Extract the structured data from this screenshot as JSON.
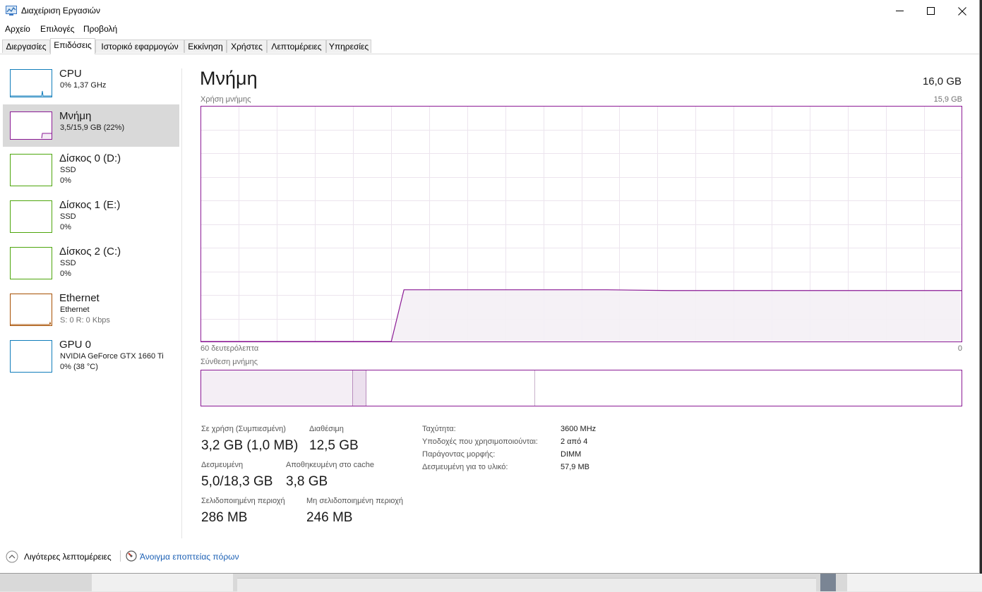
{
  "window": {
    "title": "Διαχείριση Εργασιών",
    "accent": "#8b1a95"
  },
  "menu": [
    "Αρχείο",
    "Επιλογές",
    "Προβολή"
  ],
  "tabs": [
    {
      "label": "Διεργασίες"
    },
    {
      "label": "Επιδόσεις",
      "active": true
    },
    {
      "label": "Ιστορικό εφαρμογών"
    },
    {
      "label": "Εκκίνηση"
    },
    {
      "label": "Χρήστες"
    },
    {
      "label": "Λεπτομέρειες"
    },
    {
      "label": "Υπηρεσίες"
    }
  ],
  "sidebar": {
    "items": [
      {
        "title": "CPU",
        "line1": "0% 1,37 GHz",
        "color": "#117dbb",
        "icon": "cpu-graph"
      },
      {
        "title": "Μνήμη",
        "line1": "3,5/15,9 GB (22%)",
        "color": "#8b1a95",
        "icon": "memory-graph",
        "selected": true
      },
      {
        "title": "Δίσκος 0 (D:)",
        "line1": "SSD",
        "line2": "0%",
        "color": "#4da60c",
        "icon": "disk-graph"
      },
      {
        "title": "Δίσκος 1 (E:)",
        "line1": "SSD",
        "line2": "0%",
        "color": "#4da60c",
        "icon": "disk-graph"
      },
      {
        "title": "Δίσκος 2 (C:)",
        "line1": "SSD",
        "line2": "0%",
        "color": "#4da60c",
        "icon": "disk-graph"
      },
      {
        "title": "Ethernet",
        "line1": "Ethernet",
        "line2": "S: 0 R: 0 Kbps",
        "color": "#a74f01",
        "icon": "network-graph"
      },
      {
        "title": "GPU 0",
        "line1": "NVIDIA GeForce GTX 1660 Ti",
        "line2": "0% (38 °C)",
        "color": "#117dbb",
        "icon": "gpu-graph"
      }
    ]
  },
  "main": {
    "title": "Μνήμη",
    "total": "16,0 GB",
    "usage_label": "Χρήση μνήμης",
    "usage_max": "15,9 GB",
    "time_left": "60 δευτερόλεπτα",
    "time_right": "0",
    "composition_label": "Σύνθεση μνήμης"
  },
  "chart_data": {
    "type": "area",
    "title": "Χρήση μνήμης",
    "xlabel": "",
    "ylabel": "",
    "x_range_seconds": [
      60,
      0
    ],
    "ylim": [
      0,
      15.9
    ],
    "grid": true,
    "series": [
      {
        "x": [
          60,
          45,
          44,
          28,
          23,
          0
        ],
        "values": [
          0,
          0,
          3.5,
          3.5,
          3.45,
          3.45
        ]
      }
    ]
  },
  "composition": {
    "in_use_fraction": 0.2,
    "modified_fraction": 0.018,
    "standby_fraction": 0.222,
    "free_fraction": 0.56
  },
  "stats": {
    "in_use_label": "Σε χρήση (Συμπιεσμένη)",
    "in_use_value": "3,2 GB (1,0 MB)",
    "available_label": "Διαθέσιμη",
    "available_value": "12,5 GB",
    "committed_label": "Δεσμευμένη",
    "committed_value": "5,0/18,3 GB",
    "cached_label": "Αποθηκευμένη στο cache",
    "cached_value": "3,8 GB",
    "paged_label": "Σελιδοποιημένη περιοχή",
    "paged_value": "286 MB",
    "nonpaged_label": "Μη σελιδοποιημένη περιοχή",
    "nonpaged_value": "246 MB"
  },
  "details": [
    {
      "label": "Ταχύτητα:",
      "value": "3600 MHz"
    },
    {
      "label": "Υποδοχές που χρησιμοποιούνται:",
      "value": "2 από 4"
    },
    {
      "label": "Παράγοντας μορφής:",
      "value": "DIMM"
    },
    {
      "label": "Δεσμευμένη για το υλικό:",
      "value": "57,9 MB"
    }
  ],
  "footer": {
    "fewer_details": "Λιγότερες λεπτομέρειες",
    "resource_monitor": "Άνοιγμα εποπτείας πόρων"
  }
}
